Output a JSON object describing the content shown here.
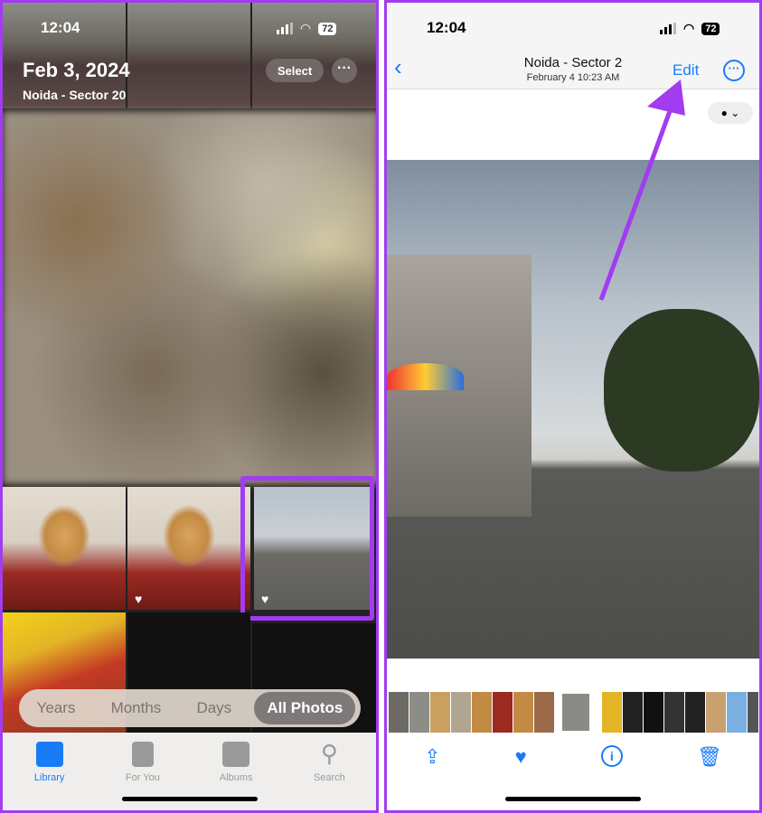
{
  "left": {
    "status": {
      "time": "12:04",
      "battery": "72"
    },
    "header": {
      "date": "Feb 3, 2024",
      "location": "Noida - Sector 20",
      "select_label": "Select",
      "more_icon": "ellipsis-icon"
    },
    "segments": [
      "Years",
      "Months",
      "Days",
      "All Photos"
    ],
    "selected_segment": "All Photos",
    "tabs": [
      {
        "label": "Library",
        "icon": "photo-library-icon"
      },
      {
        "label": "For You",
        "icon": "for-you-icon"
      },
      {
        "label": "Albums",
        "icon": "albums-icon"
      },
      {
        "label": "Search",
        "icon": "search-icon"
      }
    ],
    "active_tab": "Library",
    "accent": "#1a7cf5",
    "highlight_color": "#a23cf0"
  },
  "right": {
    "status": {
      "time": "12:04",
      "battery": "72"
    },
    "nav": {
      "title": "Noida - Sector 2",
      "subtitle": "February 4  10:23 AM",
      "edit_label": "Edit"
    },
    "toolbar": [
      "share-icon",
      "heart-icon",
      "info-icon",
      "trash-icon"
    ],
    "accent": "#1a7cf5"
  }
}
